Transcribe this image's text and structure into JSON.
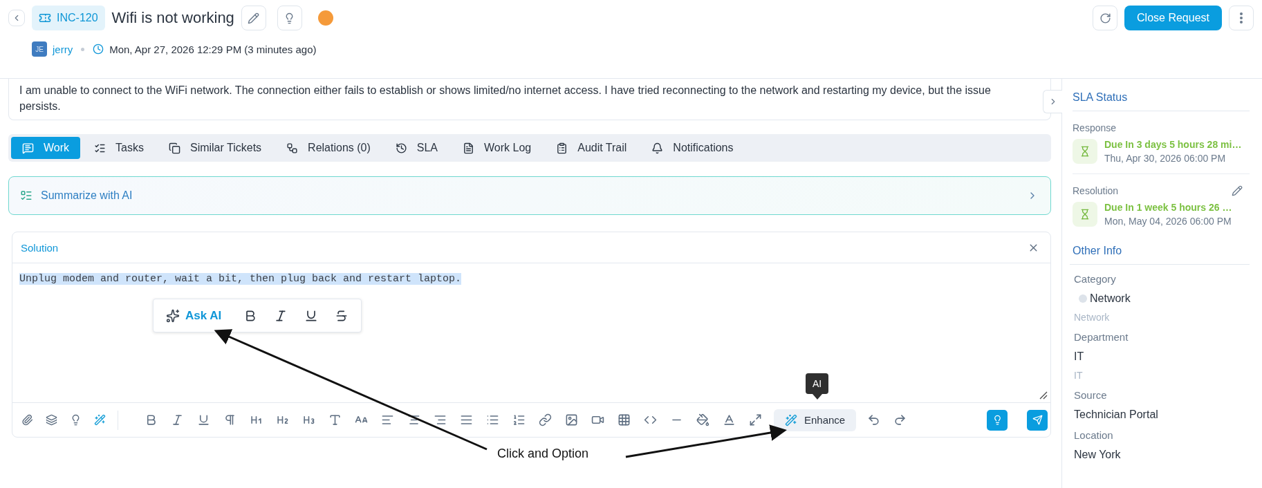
{
  "header": {
    "ticket_id": "INC-120",
    "title": "Wifi is not working",
    "requester": {
      "initials": "JE",
      "name": "jerry"
    },
    "created": "Mon, Apr 27, 2026 12:29 PM (3 minutes ago)",
    "primary_button": "Close Request"
  },
  "description": "I am unable to connect to the WiFi network. The connection either fails to establish or shows limited/no internet access. I have tried reconnecting to the network and restarting my device, but the issue persists.",
  "tabs": [
    {
      "label": "Work",
      "selected": true
    },
    {
      "label": "Tasks",
      "selected": false
    },
    {
      "label": "Similar Tickets",
      "selected": false
    },
    {
      "label": "Relations (0)",
      "selected": false
    },
    {
      "label": "SLA",
      "selected": false
    },
    {
      "label": "Work Log",
      "selected": false
    },
    {
      "label": "Audit Trail",
      "selected": false
    },
    {
      "label": "Notifications",
      "selected": false
    }
  ],
  "summarize": {
    "label": "Summarize with AI"
  },
  "editor": {
    "title": "Solution",
    "content": {
      "text": "Unplug modem and router, wait a bit, then plug back and restart laptop.",
      "selected": true
    },
    "bubble_menu": {
      "ask_ai": "Ask AI"
    },
    "enhance": {
      "label": "Enhance",
      "tooltip": "AI"
    }
  },
  "annotation": {
    "label": "Click and Option"
  },
  "sidebar": {
    "sla_title": "SLA Status",
    "sla": [
      {
        "label": "Response",
        "due": "Due In 3 days 5 hours 28 mi…",
        "date": "Thu, Apr 30, 2026 06:00 PM",
        "editable": false
      },
      {
        "label": "Resolution",
        "due": "Due In 1 week 5 hours 26 …",
        "date": "Mon, May 04, 2026 06:00 PM",
        "editable": true
      }
    ],
    "other_title": "Other Info",
    "fields": [
      {
        "label": "Category",
        "value": "Network",
        "sub": "Network",
        "kind": "tag"
      },
      {
        "label": "Department",
        "value": "IT",
        "sub": "IT",
        "kind": "plain"
      },
      {
        "label": "Source",
        "value": "Technician Portal",
        "kind": "plain"
      },
      {
        "label": "Location",
        "value": "New York",
        "kind": "plain"
      }
    ]
  }
}
